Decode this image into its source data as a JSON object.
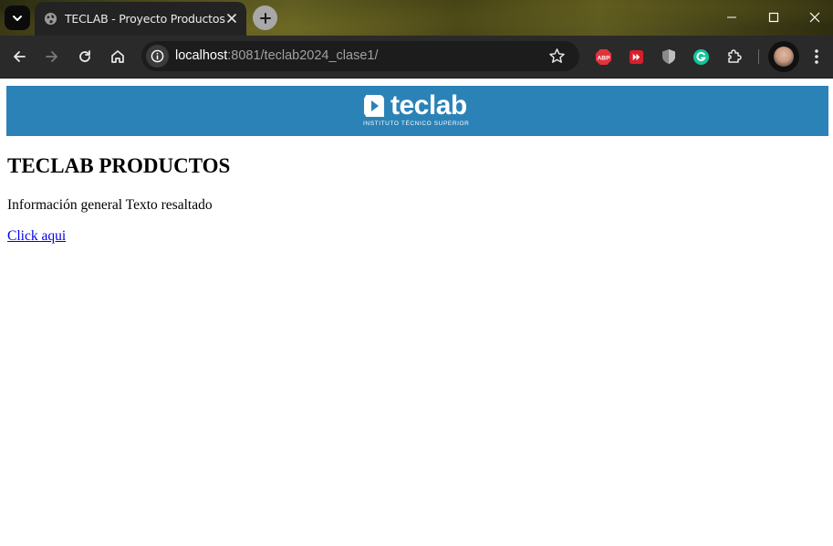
{
  "browser": {
    "tab": {
      "title": "TECLAB - Proyecto Productos"
    },
    "address_bar": {
      "host": "localhost",
      "rest": ":8081/teclab2024_clase1/"
    },
    "extensions": [
      "adblock-plus-icon",
      "fast-forward-icon",
      "shield-icon",
      "grammarly-icon",
      "extensions-puzzle-icon"
    ]
  },
  "page": {
    "logo": {
      "wordmark": "teclab",
      "tagline": "INSTITUTO TÉCNICO SUPERIOR"
    },
    "heading": "TECLAB PRODUCTOS",
    "info_text": "Información general Texto resaltado",
    "link_text": "Click aqui"
  },
  "colors": {
    "banner": "#2b82b6",
    "link": "#0000ee"
  }
}
